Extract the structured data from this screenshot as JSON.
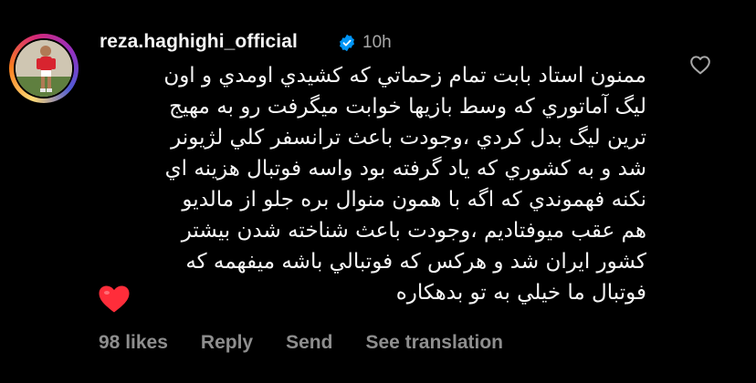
{
  "comment": {
    "username": "reza.haghighi_official",
    "time": "10h",
    "text": "ممنون استاد بابت تمام زحماتي كه كشيدي اومدي و اون\nليگ آماتوري كه وسط بازيها خوابت ميگرفت رو به مهيج\nترين ليگ بدل كردي ،وجودت باعث ترانسفر كلي لژيونر\nشد و به كشوري كه ياد گرفته بود واسه فوتبال هزينه اي\nنكنه فهموندي كه اگه با همون منوال بره جلو از مالديو\nهم عقب ميوفتاديم ،وجودت باعث شناخته شدن بيشتر\nكشور ايران شد و هركس كه فوتبالي باشه ميفهمه كه\nفوتبال ما خيلي به تو بدهكاره",
    "emoji": "❤️",
    "icons": {
      "avatar": "profile-avatar",
      "verified": "verified-badge-icon",
      "like": "heart-outline-icon",
      "emoji": "red-heart-emoji"
    }
  },
  "actions": {
    "likes": "98 likes",
    "reply": "Reply",
    "send": "Send",
    "translate": "See translation"
  },
  "colors": {
    "background": "#000000",
    "text": "#f5f5f5",
    "muted": "#8e8e8e",
    "verified": "#0095f6",
    "heart": "#ff3040"
  }
}
